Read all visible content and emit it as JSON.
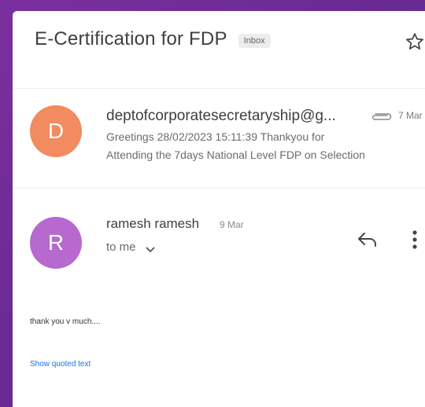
{
  "thread": {
    "subject": "E-Certification for FDP",
    "label": "Inbox"
  },
  "messages": [
    {
      "avatar_letter": "D",
      "avatar_color": "#f28b60",
      "sender": "deptofcorporatesecretaryship@g...",
      "date": "7 Mar",
      "snippet_line1": "Greetings 28/02/2023 15:11:39 Thankyou for",
      "snippet_line2": "Attending the 7days National Level FDP on Selection",
      "has_attachment": true
    },
    {
      "avatar_letter": "R",
      "avatar_color": "#b769d0",
      "sender": "ramesh ramesh",
      "date": "9 Mar",
      "to": "to me",
      "body": "thank you v much....",
      "show_quoted": "Show quoted text"
    }
  ],
  "icons": [
    "star-icon",
    "paperclip-icon",
    "chevron-down-icon",
    "reply-icon",
    "more-vert-icon"
  ]
}
